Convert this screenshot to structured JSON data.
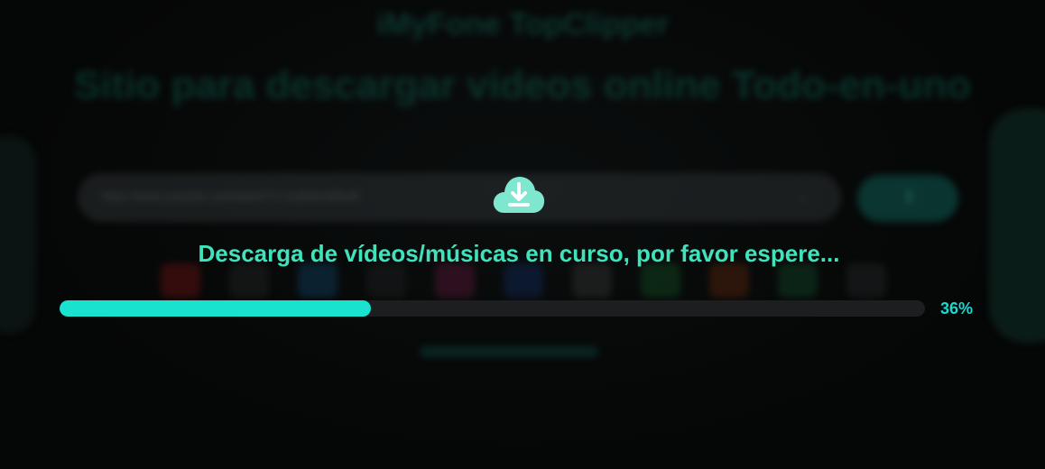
{
  "background": {
    "brand_title": "iMyFone TopClipper",
    "headline": "Sitio para descargar videos online Todo-en-uno",
    "search_value": "https://www.youtube.com/watch?v=1a2b3c4d5e6f"
  },
  "overlay": {
    "status_text": "Descarga de vídeos/músicas en curso, por favor espere...",
    "progress_percent_label": "36%",
    "progress_fraction": 0.36
  },
  "colors": {
    "accent": "#19e3cf",
    "status_text": "#3fe3bb",
    "track": "#1c1e1f"
  },
  "icons": {
    "status": "cloud-download-icon"
  },
  "platform_icons": [
    {
      "name": "youtube-icon",
      "color": "#5a1010"
    },
    {
      "name": "tiktok-icon",
      "color": "#1e1f20"
    },
    {
      "name": "twitter-icon",
      "color": "#0f3550"
    },
    {
      "name": "x-icon",
      "color": "#1a1b1c"
    },
    {
      "name": "instagram-icon",
      "color": "#4a1530"
    },
    {
      "name": "facebook-icon",
      "color": "#10234a"
    },
    {
      "name": "generic-icon",
      "color": "#2a2c2d"
    },
    {
      "name": "line-icon",
      "color": "#0f3f1c"
    },
    {
      "name": "reddit-icon",
      "color": "#4a200c"
    },
    {
      "name": "whatsapp-icon",
      "color": "#0f3a22"
    },
    {
      "name": "more-icon",
      "color": "#1f2122"
    }
  ]
}
